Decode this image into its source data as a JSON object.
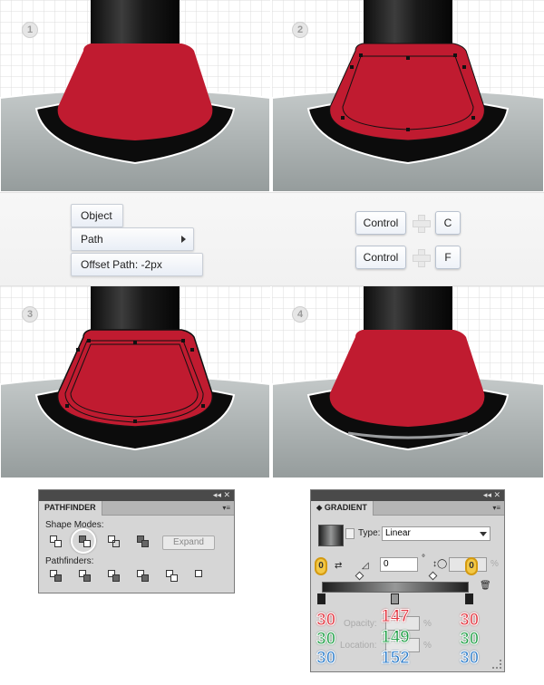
{
  "steps": {
    "s1": "1",
    "s2": "2",
    "s3": "3",
    "s4": "4"
  },
  "menu": {
    "object": "Object",
    "path": "Path",
    "offset_path": "Offset Path: -2px"
  },
  "shortcuts": {
    "copy_modifier": "Control",
    "copy_key": "C",
    "paste_modifier": "Control",
    "paste_key": "F"
  },
  "pathfinder": {
    "title": "PATHFINDER",
    "shape_modes_label": "Shape Modes:",
    "pathfinders_label": "Pathfinders:",
    "expand_label": "Expand",
    "highlighted_mode": "minus-front"
  },
  "gradient": {
    "title": "GRADIENT",
    "type_label": "Type:",
    "type_value": "Linear",
    "angle_value": "0",
    "degree_symbol": "°",
    "percent_symbol": "%",
    "opacity_label": "Opacity:",
    "location_label": "Location:",
    "left_badge": "0",
    "right_badge": "0",
    "stops": [
      {
        "r": "30",
        "g": "30",
        "b": "30"
      },
      {
        "r": "147",
        "g": "149",
        "b": "152"
      },
      {
        "r": "30",
        "g": "30",
        "b": "30"
      }
    ]
  },
  "colors": {
    "red_shape": "#c01b30",
    "dark_stroke": "#151515",
    "grid_line": "#dcdcdc",
    "ground": "#9ea4a4"
  }
}
